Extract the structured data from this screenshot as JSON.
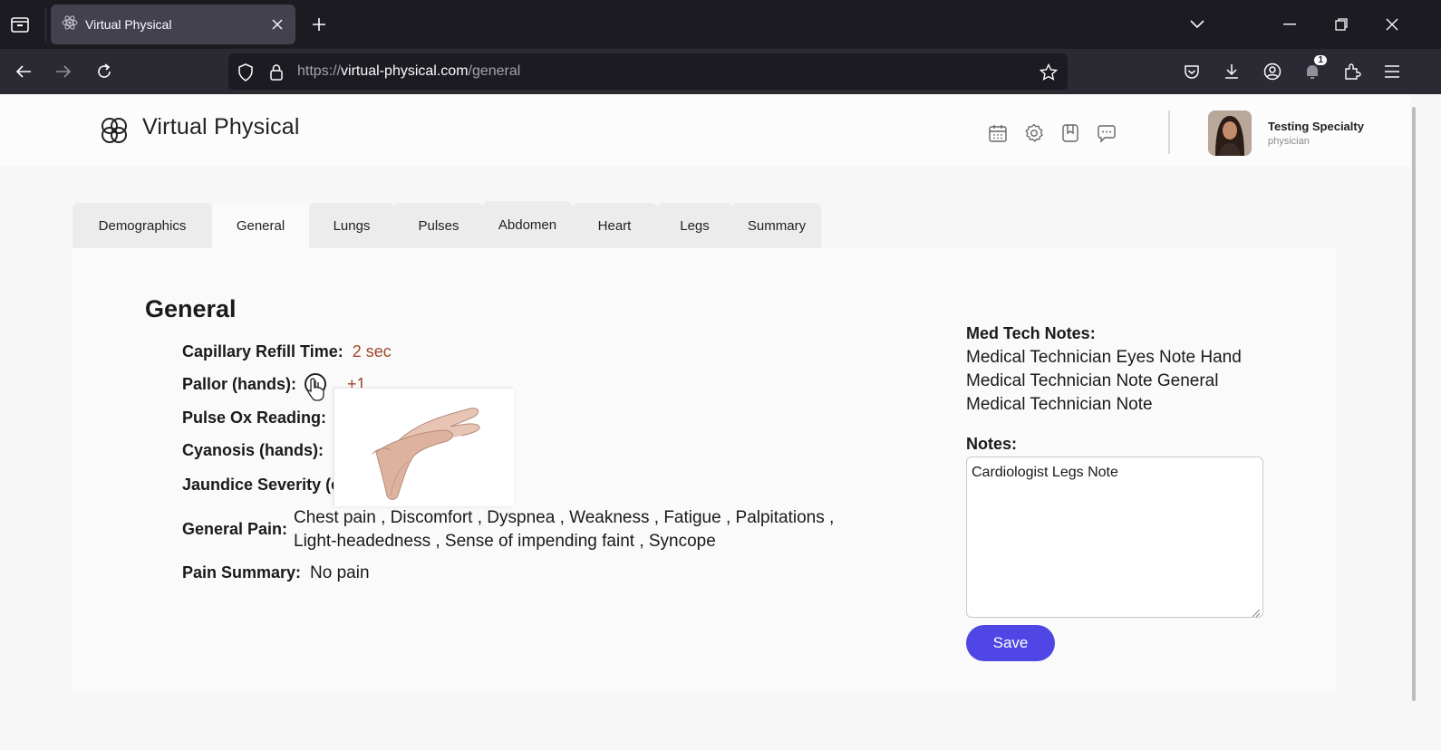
{
  "browser": {
    "tab_title": "Virtual Physical",
    "url_protocol": "https://",
    "url_domain": "virtual-physical.com",
    "url_path": "/general",
    "notification_count": "1"
  },
  "app": {
    "brand": "Virtual Physical",
    "user_name": "Testing Specialty",
    "user_role": "physician"
  },
  "tabs": [
    "Demographics",
    "General",
    "Lungs",
    "Pulses",
    "Abdomen",
    "Heart",
    "Legs",
    "Summary"
  ],
  "active_tab": "General",
  "general": {
    "title": "General",
    "capillary_label": "Capillary Refill Time:",
    "capillary_value": "2 sec",
    "pallor_label": "Pallor (hands):",
    "pallor_value": "+1",
    "pulse_ox_label": "Pulse Ox Reading:",
    "cyanosis_label": "Cyanosis (hands):",
    "jaundice_label": "Jaundice Severity (e",
    "pain_label": "General Pain:",
    "pain_line1": "Chest pain , Discomfort , Dyspnea , Weakness , Fatigue , Palpitations ,",
    "pain_line2": "Light-headedness , Sense of impending faint , Syncope",
    "pain_summary_label": "Pain Summary:",
    "pain_summary_value": "No pain"
  },
  "med_tech": {
    "title": "Med Tech Notes:",
    "lines": [
      "Medical Technician Eyes Note Hand",
      "Medical Technician Note General",
      "Medical Technician Note"
    ]
  },
  "notes": {
    "title": "Notes:",
    "value": "Cardiologist Legs Note",
    "save_label": "Save"
  },
  "colors": {
    "accent": "#4f46e5",
    "value_red": "#a0472b"
  }
}
